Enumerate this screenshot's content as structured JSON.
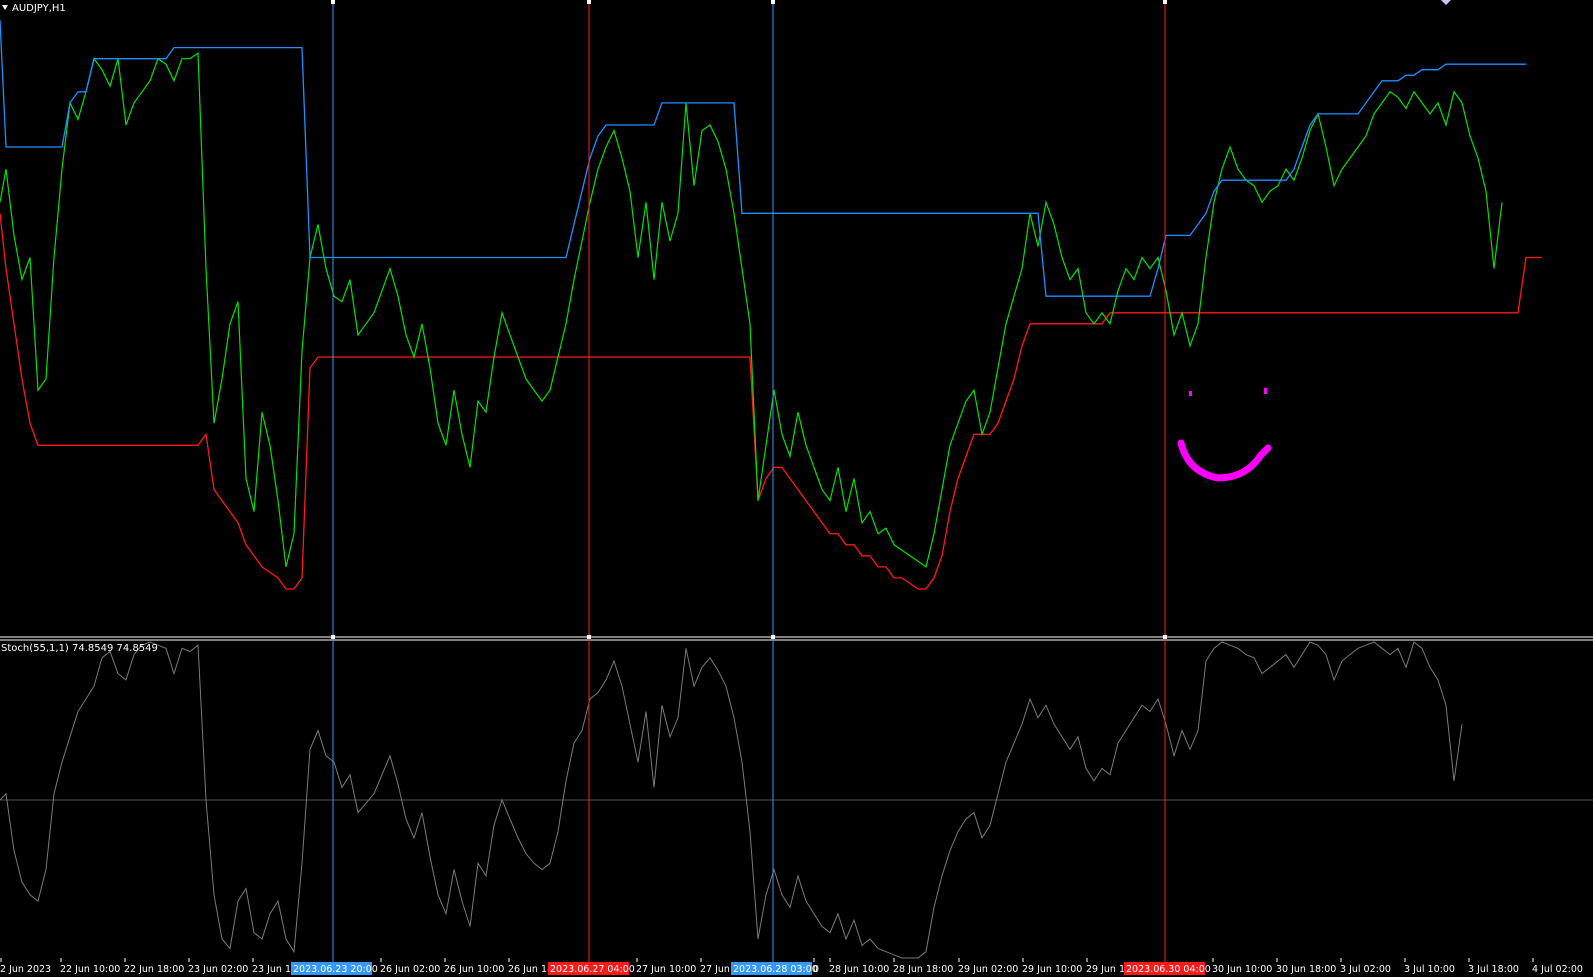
{
  "chart_header": {
    "symbol": "AUDJPY,H1",
    "dropdown_icon": "triangle-down-icon",
    "corner_marker_icon": "diamond-icon"
  },
  "colors": {
    "background": "#000000",
    "upper_line": "#1e90ff",
    "lower_line": "#ff1a1a",
    "price_line": "#00e000",
    "stoch_line": "#7a7a7a",
    "separator": "#ffffff",
    "marker_blue": "#3399ff",
    "marker_red": "#ff1a1a",
    "drawing": "#ff00ff"
  },
  "x_axis": {
    "ticks": [
      "2 Jun 2023",
      "22 Jun 10:00",
      "22 Jun 18:00",
      "23 Jun 02:00",
      "23 Jun 10",
      "26 Jun 02:00",
      "26 Jun 10:00",
      "26 Jun 18",
      "27 Jun 10:00",
      "27 Jun 1",
      "0",
      "28 Jun 10:00",
      "28 Jun 18:00",
      "29 Jun 02:00",
      "29 Jun 10:00",
      "29 Jun 18",
      "30 Jun 10:00",
      "30 Jun 18:00",
      "3 Jul 02:00",
      "3 Jul 10:00",
      "3 Jul 18:00",
      "4 Jul 02:00"
    ],
    "highlighted": [
      {
        "label": "2023.06.23 20:00",
        "color": "blue"
      },
      {
        "label": "2023.06.27 04:00",
        "color": "red"
      },
      {
        "label": "2023.06.28 03:00",
        "color": "blue"
      },
      {
        "label": "2023.06.30 04:00",
        "color": "red"
      }
    ]
  },
  "vertical_markers": [
    {
      "time": "2023.06.23 20:00",
      "color": "blue"
    },
    {
      "time": "2023.06.27 04:00",
      "color": "red"
    },
    {
      "time": "2023.06.28 03:00",
      "color": "blue"
    },
    {
      "time": "2023.06.30 04:00",
      "color": "red"
    }
  ],
  "indicator": {
    "label": "Stoch(55,1,1) 74.8549 74.8549",
    "value": 74.8549,
    "ylim": [
      0,
      100
    ],
    "level": 50
  },
  "chart_data": {
    "type": "line",
    "x": [
      0,
      6,
      14,
      22,
      30,
      38,
      46,
      54,
      62,
      70,
      78,
      86,
      94,
      102,
      110,
      118,
      126,
      134,
      142,
      150,
      158,
      166,
      174,
      182,
      190,
      198,
      206,
      214,
      222,
      230,
      238,
      246,
      254,
      262,
      270,
      278,
      286,
      294,
      302,
      310,
      318,
      326,
      334,
      342,
      350,
      358,
      366,
      374,
      382,
      390,
      398,
      406,
      414,
      422,
      430,
      438,
      446,
      454,
      462,
      470,
      478,
      486,
      494,
      502,
      510,
      518,
      526,
      534,
      542,
      550,
      558,
      566,
      574,
      582,
      590,
      598,
      606,
      614,
      622,
      630,
      638,
      646,
      654,
      662,
      670,
      678,
      686,
      694,
      702,
      710,
      718,
      726,
      734,
      742,
      750,
      758,
      766,
      774,
      782,
      790,
      798,
      806,
      814,
      822,
      830,
      838,
      846,
      854,
      862,
      870,
      878,
      886,
      894,
      902,
      910,
      918,
      926,
      934,
      942,
      950,
      958,
      966,
      974,
      982,
      990,
      998,
      1006,
      1014,
      1022,
      1030,
      1038,
      1046,
      1054,
      1062,
      1070,
      1078,
      1086,
      1094,
      1102,
      1110,
      1118,
      1126,
      1134,
      1142,
      1150,
      1158,
      1166,
      1174,
      1182,
      1190,
      1198,
      1206,
      1214,
      1222,
      1230,
      1238,
      1246,
      1254,
      1262,
      1270,
      1278,
      1286,
      1294,
      1302,
      1310,
      1318,
      1326,
      1334,
      1342,
      1350,
      1358,
      1366,
      1374,
      1382,
      1390,
      1398,
      1406,
      1414,
      1422,
      1430,
      1438,
      1446,
      1454,
      1462,
      1470,
      1478,
      1486,
      1494,
      1502,
      1510,
      1518,
      1526,
      1534,
      1542,
      1550,
      1558,
      1566
    ],
    "price": [
      0.72,
      0.78,
      0.66,
      0.58,
      0.62,
      0.38,
      0.4,
      0.62,
      0.78,
      0.9,
      0.87,
      0.92,
      0.98,
      0.96,
      0.93,
      0.98,
      0.86,
      0.9,
      0.92,
      0.94,
      0.98,
      0.97,
      0.94,
      0.98,
      0.98,
      0.99,
      0.6,
      0.32,
      0.4,
      0.5,
      0.54,
      0.22,
      0.16,
      0.34,
      0.28,
      0.18,
      0.06,
      0.12,
      0.45,
      0.62,
      0.68,
      0.6,
      0.55,
      0.54,
      0.58,
      0.48,
      0.5,
      0.52,
      0.56,
      0.6,
      0.55,
      0.48,
      0.44,
      0.5,
      0.42,
      0.32,
      0.28,
      0.38,
      0.3,
      0.24,
      0.36,
      0.34,
      0.44,
      0.52,
      0.48,
      0.44,
      0.4,
      0.38,
      0.36,
      0.38,
      0.44,
      0.5,
      0.58,
      0.65,
      0.72,
      0.78,
      0.82,
      0.85,
      0.8,
      0.74,
      0.62,
      0.72,
      0.58,
      0.72,
      0.65,
      0.7,
      0.9,
      0.75,
      0.85,
      0.86,
      0.83,
      0.78,
      0.7,
      0.6,
      0.5,
      0.18,
      0.28,
      0.38,
      0.3,
      0.26,
      0.34,
      0.28,
      0.24,
      0.2,
      0.18,
      0.24,
      0.16,
      0.22,
      0.14,
      0.16,
      0.12,
      0.13,
      0.1,
      0.09,
      0.08,
      0.07,
      0.06,
      0.12,
      0.2,
      0.28,
      0.32,
      0.36,
      0.38,
      0.3,
      0.34,
      0.42,
      0.5,
      0.55,
      0.6,
      0.7,
      0.64,
      0.72,
      0.68,
      0.62,
      0.58,
      0.6,
      0.52,
      0.5,
      0.52,
      0.5,
      0.56,
      0.6,
      0.58,
      0.62,
      0.6,
      0.62,
      0.56,
      0.48,
      0.52,
      0.46,
      0.5,
      0.62,
      0.72,
      0.78,
      0.82,
      0.78,
      0.76,
      0.75,
      0.72,
      0.74,
      0.75,
      0.78,
      0.76,
      0.8,
      0.85,
      0.88,
      0.82,
      0.75,
      0.78,
      0.8,
      0.82,
      0.84,
      0.88,
      0.9,
      0.92,
      0.91,
      0.89,
      0.92,
      0.9,
      0.88,
      0.9,
      0.86,
      0.92,
      0.9,
      0.84,
      0.8,
      0.74,
      0.6,
      0.72
    ],
    "upper": [
      1.05,
      0.82,
      0.82,
      0.82,
      0.82,
      0.82,
      0.82,
      0.82,
      0.82,
      0.9,
      0.92,
      0.92,
      0.98,
      0.98,
      0.98,
      0.98,
      0.98,
      0.98,
      0.98,
      0.98,
      0.98,
      0.98,
      1.0,
      1.0,
      1.0,
      1.0,
      1.0,
      1.0,
      1.0,
      1.0,
      1.0,
      1.0,
      1.0,
      1.0,
      1.0,
      1.0,
      1.0,
      1.0,
      1.0,
      0.62,
      0.62,
      0.62,
      0.62,
      0.62,
      0.62,
      0.62,
      0.62,
      0.62,
      0.62,
      0.62,
      0.62,
      0.62,
      0.62,
      0.62,
      0.62,
      0.62,
      0.62,
      0.62,
      0.62,
      0.62,
      0.62,
      0.62,
      0.62,
      0.62,
      0.62,
      0.62,
      0.62,
      0.62,
      0.62,
      0.62,
      0.62,
      0.62,
      0.68,
      0.74,
      0.8,
      0.84,
      0.86,
      0.86,
      0.86,
      0.86,
      0.86,
      0.86,
      0.86,
      0.9,
      0.9,
      0.9,
      0.9,
      0.9,
      0.9,
      0.9,
      0.9,
      0.9,
      0.9,
      0.7,
      0.7,
      0.7,
      0.7,
      0.7,
      0.7,
      0.7,
      0.7,
      0.7,
      0.7,
      0.7,
      0.7,
      0.7,
      0.7,
      0.7,
      0.7,
      0.7,
      0.7,
      0.7,
      0.7,
      0.7,
      0.7,
      0.7,
      0.7,
      0.7,
      0.7,
      0.7,
      0.7,
      0.7,
      0.7,
      0.7,
      0.7,
      0.7,
      0.7,
      0.7,
      0.7,
      0.7,
      0.7,
      0.55,
      0.55,
      0.55,
      0.55,
      0.55,
      0.55,
      0.55,
      0.55,
      0.55,
      0.55,
      0.55,
      0.55,
      0.55,
      0.55,
      0.6,
      0.66,
      0.66,
      0.66,
      0.66,
      0.68,
      0.7,
      0.74,
      0.76,
      0.76,
      0.76,
      0.76,
      0.76,
      0.76,
      0.76,
      0.76,
      0.76,
      0.78,
      0.82,
      0.86,
      0.88,
      0.88,
      0.88,
      0.88,
      0.88,
      0.88,
      0.9,
      0.92,
      0.94,
      0.94,
      0.94,
      0.95,
      0.95,
      0.96,
      0.96,
      0.96,
      0.97,
      0.97,
      0.97,
      0.97,
      0.97,
      0.97,
      0.97,
      0.97,
      0.97,
      0.97,
      0.97
    ],
    "lower": [
      0.7,
      0.6,
      0.5,
      0.4,
      0.32,
      0.28,
      0.28,
      0.28,
      0.28,
      0.28,
      0.28,
      0.28,
      0.28,
      0.28,
      0.28,
      0.28,
      0.28,
      0.28,
      0.28,
      0.28,
      0.28,
      0.28,
      0.28,
      0.28,
      0.28,
      0.28,
      0.3,
      0.2,
      0.18,
      0.16,
      0.14,
      0.1,
      0.08,
      0.06,
      0.05,
      0.04,
      0.02,
      0.02,
      0.04,
      0.42,
      0.44,
      0.44,
      0.44,
      0.44,
      0.44,
      0.44,
      0.44,
      0.44,
      0.44,
      0.44,
      0.44,
      0.44,
      0.44,
      0.44,
      0.44,
      0.44,
      0.44,
      0.44,
      0.44,
      0.44,
      0.44,
      0.44,
      0.44,
      0.44,
      0.44,
      0.44,
      0.44,
      0.44,
      0.44,
      0.44,
      0.44,
      0.44,
      0.44,
      0.44,
      0.44,
      0.44,
      0.44,
      0.44,
      0.44,
      0.44,
      0.44,
      0.44,
      0.44,
      0.44,
      0.44,
      0.44,
      0.44,
      0.44,
      0.44,
      0.44,
      0.44,
      0.44,
      0.44,
      0.44,
      0.44,
      0.18,
      0.22,
      0.24,
      0.24,
      0.22,
      0.2,
      0.18,
      0.16,
      0.14,
      0.12,
      0.12,
      0.1,
      0.1,
      0.08,
      0.08,
      0.06,
      0.06,
      0.04,
      0.04,
      0.03,
      0.02,
      0.02,
      0.04,
      0.08,
      0.16,
      0.22,
      0.26,
      0.3,
      0.3,
      0.3,
      0.32,
      0.36,
      0.4,
      0.46,
      0.5,
      0.5,
      0.5,
      0.5,
      0.5,
      0.5,
      0.5,
      0.5,
      0.5,
      0.5,
      0.52,
      0.52,
      0.52,
      0.52,
      0.52,
      0.52,
      0.52,
      0.52,
      0.52,
      0.52,
      0.52,
      0.52,
      0.52,
      0.52,
      0.52,
      0.52,
      0.52,
      0.52,
      0.52,
      0.52,
      0.52,
      0.52,
      0.52,
      0.52,
      0.52,
      0.52,
      0.52,
      0.52,
      0.52,
      0.52,
      0.52,
      0.52,
      0.52,
      0.52,
      0.52,
      0.52,
      0.52,
      0.52,
      0.52,
      0.52,
      0.52,
      0.52,
      0.52,
      0.52,
      0.52,
      0.52,
      0.52,
      0.52,
      0.52,
      0.52,
      0.52,
      0.52,
      0.62,
      0.62,
      0.62
    ],
    "stoch": [
      50,
      52,
      34,
      24,
      20,
      18,
      28,
      52,
      62,
      70,
      78,
      82,
      86,
      95,
      97,
      90,
      88,
      96,
      99,
      100,
      99,
      98,
      90,
      98,
      97,
      99,
      50,
      20,
      6,
      3,
      18,
      22,
      8,
      6,
      14,
      18,
      6,
      2,
      30,
      66,
      72,
      64,
      62,
      54,
      58,
      46,
      49,
      52,
      58,
      64,
      55,
      44,
      38,
      46,
      32,
      20,
      14,
      28,
      18,
      10,
      30,
      26,
      42,
      50,
      44,
      38,
      33,
      30,
      28,
      30,
      40,
      56,
      68,
      72,
      82,
      84,
      88,
      94,
      86,
      74,
      62,
      78,
      54,
      80,
      70,
      76,
      98,
      86,
      92,
      95,
      91,
      86,
      76,
      62,
      40,
      6,
      20,
      28,
      20,
      16,
      26,
      18,
      14,
      10,
      8,
      14,
      6,
      12,
      4,
      6,
      3,
      2,
      1,
      0,
      0,
      0,
      2,
      16,
      26,
      34,
      40,
      44,
      46,
      38,
      42,
      52,
      62,
      68,
      74,
      82,
      76,
      80,
      74,
      70,
      66,
      70,
      60,
      56,
      60,
      58,
      68,
      72,
      76,
      80,
      78,
      82,
      74,
      64,
      72,
      66,
      72,
      94,
      98,
      100,
      99,
      98,
      96,
      95,
      90,
      92,
      94,
      96,
      92,
      96,
      100,
      99,
      96,
      88,
      94,
      96,
      98,
      99,
      100,
      98,
      96,
      98,
      92,
      100,
      98,
      92,
      88,
      80,
      56,
      74
    ],
    "ylim": [
      0,
      1.05
    ]
  }
}
